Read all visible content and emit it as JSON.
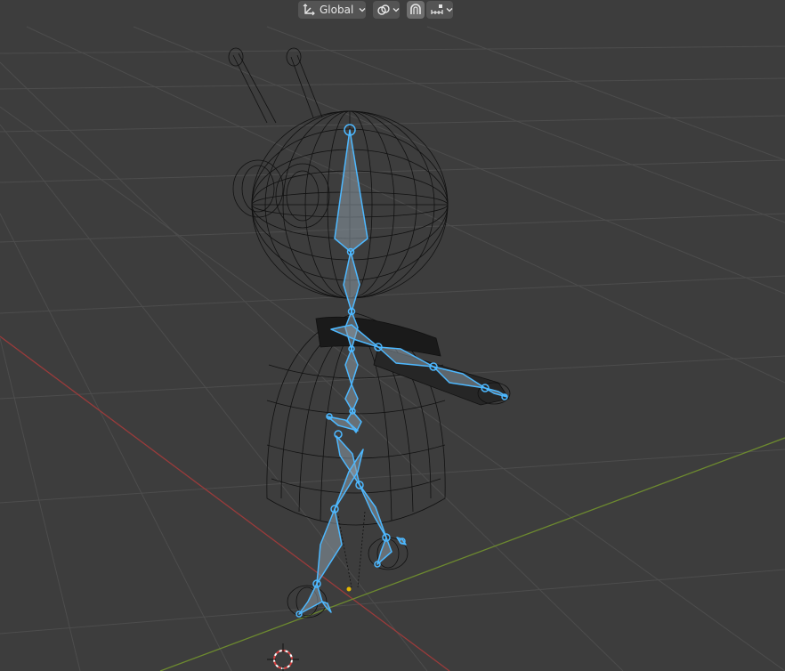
{
  "toolbar": {
    "transform_orientation": {
      "label": "Global",
      "icon": "orientation-gizmo-icon"
    },
    "pivot_point": {
      "icon": "pivot-link-icon"
    },
    "snapping": {
      "icon": "magnet-snap-icon",
      "active": true
    },
    "snap_target": {
      "icon": "snap-increment-icon"
    }
  },
  "scene": {
    "background": "#3d3d3d",
    "grid_color": "#4d4d4d",
    "x_axis_color": "#9a3b3b",
    "y_axis_color": "#6d8a2f",
    "bone_color": "#4db8ff",
    "wire_color": "#111111"
  }
}
